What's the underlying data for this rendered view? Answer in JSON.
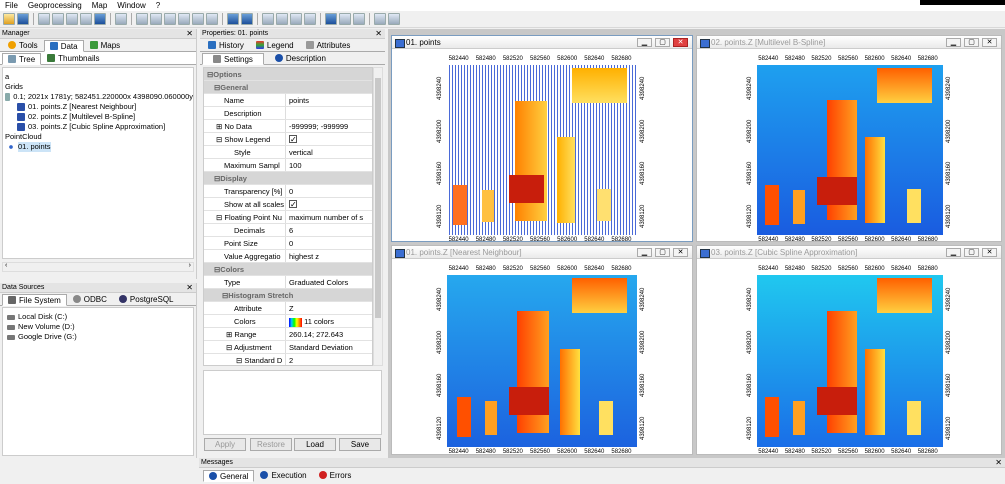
{
  "menu": [
    "File",
    "Geoprocessing",
    "Map",
    "Window",
    "?"
  ],
  "manager": {
    "title": "Manager",
    "tabs": [
      "Tools",
      "Data",
      "Maps"
    ],
    "subtabs": [
      "Tree",
      "Thumbnails"
    ],
    "tree": [
      "a",
      "Grids",
      "0.1; 2021x 1781y; 582451.220000x 4398090.060000y",
      "01. points.Z [Nearest Neighbour]",
      "02. points.Z [Multilevel B-Spline]",
      "03. points.Z [Cubic Spline Approximation]",
      "PointCloud",
      "01. points"
    ]
  },
  "datasources": {
    "title": "Data Sources",
    "tabs": [
      "File System",
      "ODBC",
      "PostgreSQL"
    ],
    "items": [
      "Local Disk (C:)",
      "New Volume (D:)",
      "Google Drive (G:)"
    ]
  },
  "properties": {
    "title": "Properties: 01. points",
    "tabs1": [
      "History",
      "Legend",
      "Attributes"
    ],
    "tabs2": [
      "Settings",
      "Description"
    ],
    "rows": [
      {
        "k": "Options",
        "cat": true
      },
      {
        "k": "General",
        "cat": true
      },
      {
        "k": "Name",
        "v": "points"
      },
      {
        "k": "Description",
        "v": ""
      },
      {
        "k": "No Data",
        "v": "-999999; -999999"
      },
      {
        "k": "Show Legend",
        "v": ""
      },
      {
        "k": "Style",
        "v": "vertical"
      },
      {
        "k": "Maximum Sampl",
        "v": "100"
      },
      {
        "k": "Display",
        "cat": true
      },
      {
        "k": "Transparency [%]",
        "v": "0"
      },
      {
        "k": "Show at all scales",
        "v": ""
      },
      {
        "k": "Floating Point Nu",
        "v": "maximum number of s"
      },
      {
        "k": "Decimals",
        "v": "6"
      },
      {
        "k": "Point Size",
        "v": "0"
      },
      {
        "k": "Value Aggregatio",
        "v": "highest z"
      },
      {
        "k": "Colors",
        "cat": true
      },
      {
        "k": "Type",
        "v": "Graduated Colors"
      },
      {
        "k": "Histogram Stretch",
        "cat": true
      },
      {
        "k": "Attribute",
        "v": "Z"
      },
      {
        "k": "Colors",
        "v": "11 colors"
      },
      {
        "k": "Range",
        "v": "260.14; 272.643"
      },
      {
        "k": "Adjustment",
        "v": "Standard Deviation"
      },
      {
        "k": "Standard D",
        "v": "2"
      }
    ],
    "buttons": [
      "Apply",
      "Restore",
      "Load",
      "Save"
    ]
  },
  "maps": [
    {
      "title": "01. points",
      "active": true
    },
    {
      "title": "02. points.Z [Multilevel B-Spline]",
      "active": false
    },
    {
      "title": "01. points.Z [Nearest Neighbour]",
      "active": false
    },
    {
      "title": "03. points.Z [Cubic Spline Approximation]",
      "active": false
    }
  ],
  "xticks": [
    "582440",
    "582480",
    "582520",
    "582560",
    "582600",
    "582640",
    "582680"
  ],
  "yticks": [
    "4398240",
    "4398200",
    "4398160",
    "4398120"
  ],
  "messages": {
    "title": "Messages",
    "tabs": [
      "General",
      "Execution",
      "Errors"
    ]
  },
  "colors": {
    "accent": "#3b6ed2",
    "blue_bg": "#1a6ee8",
    "red": "#c81e0c"
  }
}
